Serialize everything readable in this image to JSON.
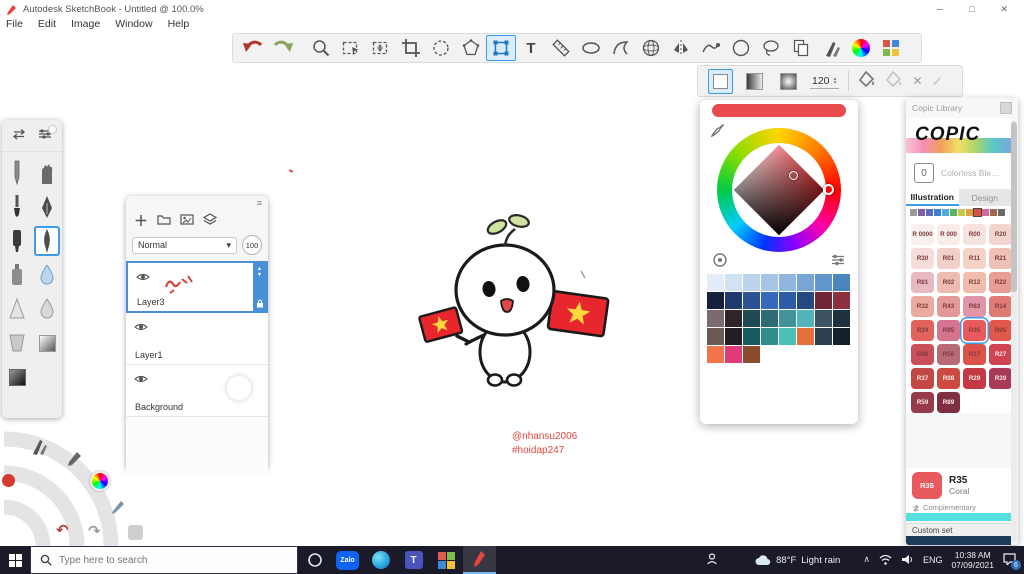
{
  "window": {
    "title": "Autodesk SketchBook - Untitled @ 100.0%"
  },
  "menu": {
    "items": [
      "File",
      "Edit",
      "Image",
      "Window",
      "Help"
    ]
  },
  "toolbar": {
    "tools": [
      {
        "name": "undo",
        "icon": "undo"
      },
      {
        "name": "redo",
        "icon": "redo"
      },
      {
        "name": "zoom",
        "icon": "magnifier"
      },
      {
        "name": "selection",
        "icon": "marquee"
      },
      {
        "name": "transform-selection",
        "icon": "marqueearrow"
      },
      {
        "name": "crop",
        "icon": "crop"
      },
      {
        "name": "nudge",
        "icon": "dashcircle"
      },
      {
        "name": "polyline-selection",
        "icon": "polygon"
      },
      {
        "name": "distort-transform",
        "icon": "distort",
        "selected": true
      },
      {
        "name": "text",
        "icon": "text"
      },
      {
        "name": "ruler",
        "icon": "ruler"
      },
      {
        "name": "ellipse-guide",
        "icon": "ellipse"
      },
      {
        "name": "french-curve",
        "icon": "frenchcurve"
      },
      {
        "name": "perspective",
        "icon": "sphere"
      },
      {
        "name": "symmetry",
        "icon": "symmetry"
      },
      {
        "name": "steady-stroke",
        "icon": "stroke"
      },
      {
        "name": "shape-circle",
        "icon": "circle"
      },
      {
        "name": "predictive-stroke",
        "icon": "lasso"
      },
      {
        "name": "import-image",
        "icon": "copy"
      },
      {
        "name": "brush-library",
        "icon": "brushes"
      },
      {
        "name": "color-editor",
        "icon": "colorwheel"
      },
      {
        "name": "swatch-palette",
        "icon": "swatchgrid"
      }
    ]
  },
  "fill_bar": {
    "size_value": "120",
    "modes": [
      "solid",
      "linear-gradient",
      "radial-gradient"
    ]
  },
  "brush_panel": {
    "tools": [
      {
        "name": "pencil",
        "icon": "pencil"
      },
      {
        "name": "smudge",
        "icon": "glove"
      },
      {
        "name": "paintbrush",
        "icon": "paintbrush"
      },
      {
        "name": "ink-pen",
        "icon": "inkpen"
      },
      {
        "name": "marker",
        "icon": "marker"
      },
      {
        "name": "brush-pen",
        "icon": "brushpen",
        "selected": true
      },
      {
        "name": "airbrush",
        "icon": "bottle"
      },
      {
        "name": "water-drop",
        "icon": "droplet"
      },
      {
        "name": "eraser-cone",
        "icon": "cone"
      },
      {
        "name": "blur-drop",
        "icon": "droplet2"
      },
      {
        "name": "flat-brush",
        "icon": "flat"
      },
      {
        "name": "gradient-flood",
        "icon": "gradsq"
      },
      {
        "name": "dark-gradient",
        "icon": "darksq"
      }
    ]
  },
  "layers_panel": {
    "blend_mode": "Normal",
    "opacity": "100",
    "layers": [
      {
        "name": "Layer3",
        "selected": true,
        "thumb": "scribble"
      },
      {
        "name": "Layer1",
        "selected": false,
        "thumb": "blank"
      },
      {
        "name": "Background",
        "selected": false,
        "thumb": "white-circle"
      }
    ]
  },
  "color_panel": {
    "current_color": "#e84a4e",
    "swatch_rows": [
      [
        "#e4ecf7",
        "#d3e2f2",
        "#bdd3ec",
        "#a6c5e5",
        "#8fb6de",
        "#77a5d4",
        "#6096ca",
        "#4a86bd"
      ],
      [
        "#15213d",
        "#1e3a6e",
        "#2a5295",
        "#3569bb",
        "#2d5ca6",
        "#224a80",
        "#6f2636",
        "#8c3040"
      ],
      [
        "#7b6a70",
        "#2e2429",
        "#1f4a55",
        "#2f6b74",
        "#41929a",
        "#52b4bb",
        "#3d5263",
        "#1f303f"
      ],
      [
        "#6b5a54",
        "#241d22",
        "#175a60",
        "#2f8d8a",
        "#4cc0b5",
        "#e4703c",
        "#2b3f50",
        "#14222c"
      ],
      [
        "#f2744a",
        "#e23a76",
        "#8a4a2c"
      ]
    ]
  },
  "copic_panel": {
    "title": "Copic Library",
    "logo_text": "COPIC",
    "blender_code": "0",
    "blender_label": "Colorless Blender",
    "tabs": [
      {
        "label": "Illustration",
        "active": true
      },
      {
        "label": "Design",
        "active": false
      }
    ],
    "family_strip": [
      "#9b9b9b",
      "#7d5fa8",
      "#5b6abf",
      "#3f7fd0",
      "#53a8dd",
      "#5bb55e",
      "#c9c94a",
      "#e0a23f",
      "#d9534a",
      "#d06a9a",
      "#a06a4a",
      "#6a6a6a"
    ],
    "swatches": [
      {
        "code": "R 0000",
        "color": "#f8f0ef"
      },
      {
        "code": "R 000",
        "color": "#f9ece9"
      },
      {
        "code": "R00",
        "color": "#f7e3dd"
      },
      {
        "code": "R20",
        "color": "#f3d5d0"
      },
      {
        "code": "R30",
        "color": "#f6dcda"
      },
      {
        "code": "R01",
        "color": "#f2cfc9"
      },
      {
        "code": "R11",
        "color": "#f5d2c6"
      },
      {
        "code": "R21",
        "color": "#efc1b5"
      },
      {
        "code": "R81",
        "color": "#e9b9c2"
      },
      {
        "code": "R02",
        "color": "#eebbb1"
      },
      {
        "code": "R12",
        "color": "#f0bcab"
      },
      {
        "code": "R22",
        "color": "#e89e94"
      },
      {
        "code": "R32",
        "color": "#eba9a0"
      },
      {
        "code": "R43",
        "color": "#e59898"
      },
      {
        "code": "R83",
        "color": "#e295a8"
      },
      {
        "code": "R14",
        "color": "#e07a75"
      },
      {
        "code": "R24",
        "color": "#e2625c"
      },
      {
        "code": "R85",
        "color": "#d4748f"
      },
      {
        "code": "R35",
        "color": "#e85a5e",
        "selected": true
      },
      {
        "code": "R05",
        "color": "#e2574b"
      },
      {
        "code": "R46",
        "color": "#c94f5a"
      },
      {
        "code": "R56",
        "color": "#b96a77"
      },
      {
        "code": "R17",
        "color": "#d9534a"
      },
      {
        "code": "R27",
        "color": "#cf4352"
      },
      {
        "code": "R37",
        "color": "#c24844"
      },
      {
        "code": "R08",
        "color": "#cc4a40"
      },
      {
        "code": "R29",
        "color": "#c43a44"
      },
      {
        "code": "R39",
        "color": "#a93a55"
      },
      {
        "code": "R59",
        "color": "#973a4a"
      },
      {
        "code": "R89",
        "color": "#7e3040"
      }
    ],
    "selected": {
      "code": "R35",
      "name": "Coral",
      "color": "#e85a5e"
    },
    "complementary_label": "Complementary",
    "complementary_color": "#55e0de",
    "custom_set_label": "Custom set",
    "custom_set_color": "#1c3b5a"
  },
  "canvas": {
    "watermark_line1": "@nhansu2006",
    "watermark_line2": "#hoidap247",
    "watermark_color": "#e8453c"
  },
  "taskbar": {
    "search_placeholder": "Type here to search",
    "apps": [
      {
        "name": "cortana",
        "icon": "cortana"
      },
      {
        "name": "zalo",
        "icon": "zalo",
        "label": "Zalo"
      },
      {
        "name": "edge",
        "icon": "edge"
      },
      {
        "name": "teams",
        "icon": "teams"
      },
      {
        "name": "app-grid",
        "icon": "gridapp"
      },
      {
        "name": "sketchbook",
        "icon": "sbpencil",
        "active": true
      }
    ],
    "weather_temp": "88°F",
    "weather_desc": "Light rain",
    "language": "ENG",
    "time": "10:38 AM",
    "date": "07/09/2021",
    "notification_count": "6"
  }
}
